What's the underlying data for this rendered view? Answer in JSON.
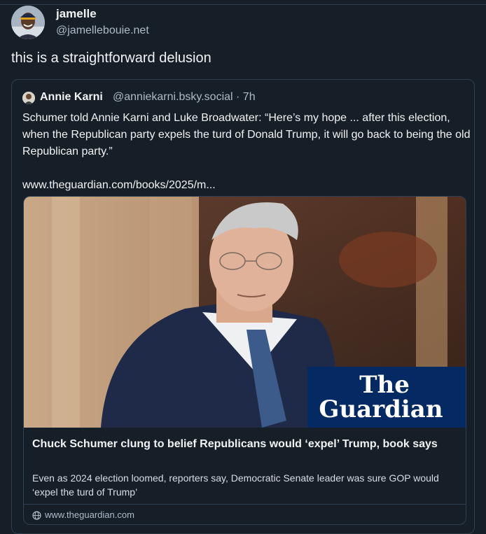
{
  "post": {
    "display_name": "jamelle",
    "handle": "@jamellebouie.net",
    "text": "this is a straightforward delusion"
  },
  "quote": {
    "display_name": "Annie Karni",
    "handle_time": "@anniekarni.bsky.social · 7h",
    "body": "Schumer told Annie Karni and Luke Broadwater: “Here’s my hope ... after this election, when the Republican party expels the turd of Donald Trump, it will go back to being the old Republican party.”\n\nwww.theguardian.com/books/2025/m..."
  },
  "link_card": {
    "logo_line1": "The",
    "logo_line2": "Guardian",
    "title": "Chuck Schumer clung to belief Republicans would ‘expel’ Trump, book says",
    "description": "Even as 2024 election loomed, reporters say, Democratic Senate leader was sure GOP would ‘expel the turd of Trump’",
    "domain": "www.theguardian.com"
  },
  "colors": {
    "background": "#161e27",
    "border": "#2e4052",
    "muted_text": "#aebbc9",
    "guardian_blue": "#052962"
  }
}
